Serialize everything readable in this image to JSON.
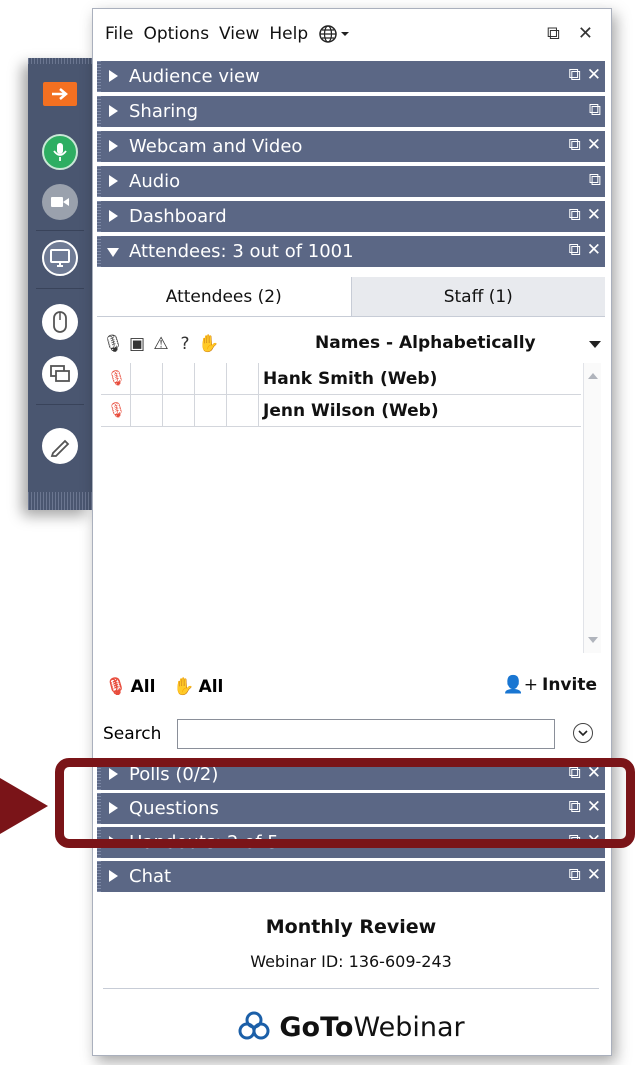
{
  "menu": {
    "items": [
      "File",
      "Options",
      "View",
      "Help"
    ],
    "globe_icon": "globe-icon"
  },
  "panels": [
    {
      "label": "Audience view",
      "expanded": false
    },
    {
      "label": "Sharing",
      "expanded": false
    },
    {
      "label": "Webcam and Video",
      "expanded": false
    },
    {
      "label": "Audio",
      "expanded": false
    },
    {
      "label": "Dashboard",
      "expanded": false
    },
    {
      "label": "Attendees: 3 out of 1001",
      "expanded": true
    },
    {
      "label": "Polls (0/2)",
      "expanded": false
    },
    {
      "label": "Questions",
      "expanded": false
    },
    {
      "label": "Handouts: 2 of 5",
      "expanded": false
    },
    {
      "label": "Chat",
      "expanded": false
    }
  ],
  "attendees": {
    "tabs": [
      "Attendees (2)",
      "Staff (1)"
    ],
    "sort_label": "Names - Alphabetically",
    "rows": [
      {
        "name": "Hank Smith (Web)"
      },
      {
        "name": "Jenn Wilson (Web)"
      }
    ],
    "mute_all": "All",
    "lower_hands_all": "All",
    "invite": "Invite",
    "search_label": "Search",
    "search_value": ""
  },
  "footer": {
    "webinar_title": "Monthly Review",
    "webinar_id": "Webinar ID: 136-609-243",
    "brand_goto": "GoTo",
    "brand_webinar": "Webinar"
  },
  "colors": {
    "header_bg": "#5b6785",
    "strip_bg": "#4a5670",
    "mic_green": "#2eae62",
    "orange": "#f37021",
    "callout": "#7a1418"
  }
}
